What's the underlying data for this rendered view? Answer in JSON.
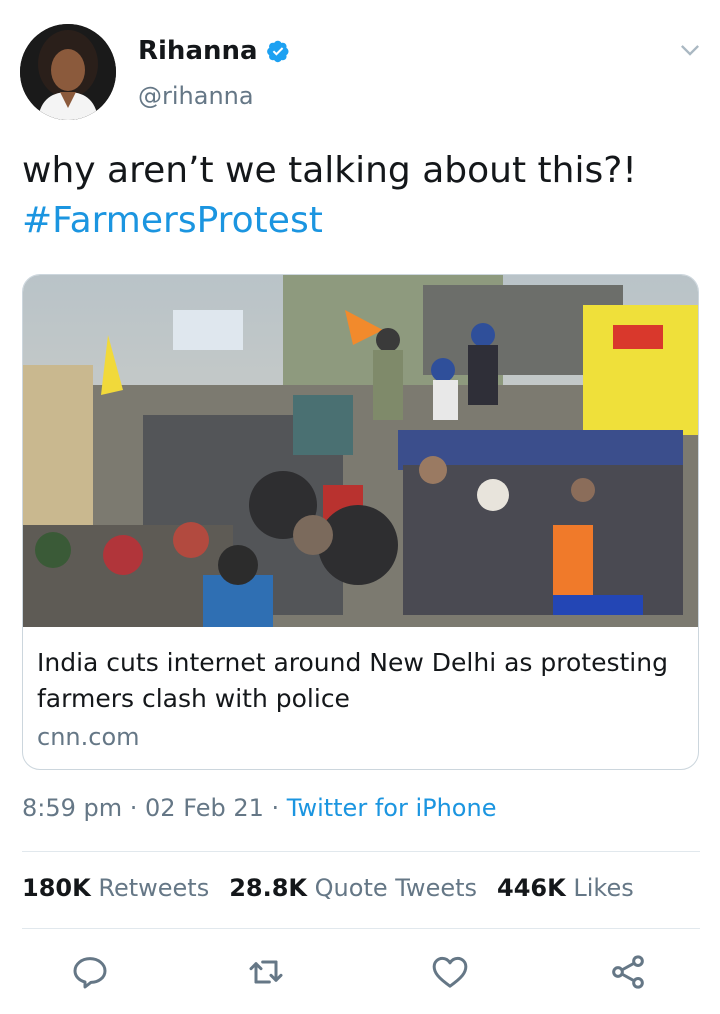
{
  "user": {
    "name": "Rihanna",
    "handle": "@rihanna",
    "verified": true,
    "avatar_icon": "profile-photo"
  },
  "tweet": {
    "text": "why aren’t we talking about this?!",
    "hashtag": "#FarmersProtest"
  },
  "card": {
    "image_description_icon": "news-photo",
    "title": "India cuts internet around New Delhi as protesting farmers clash with police",
    "domain": "cnn.com"
  },
  "meta": {
    "time": "8:59 pm",
    "separator": " · ",
    "date": "02 Feb 21",
    "source": "Twitter for iPhone"
  },
  "stats": {
    "retweets_count": "180K",
    "retweets_label": "Retweets",
    "quotes_count": "28.8K",
    "quotes_label": "Quote Tweets",
    "likes_count": "446K",
    "likes_label": "Likes"
  },
  "colors": {
    "link": "#1b95e0",
    "secondary_text": "#657786",
    "primary_text": "#14171a",
    "divider": "#e1e8ed"
  },
  "icons": [
    "verified-badge-icon",
    "chevron-down-icon",
    "reply-icon",
    "retweet-icon",
    "like-icon",
    "share-icon"
  ]
}
